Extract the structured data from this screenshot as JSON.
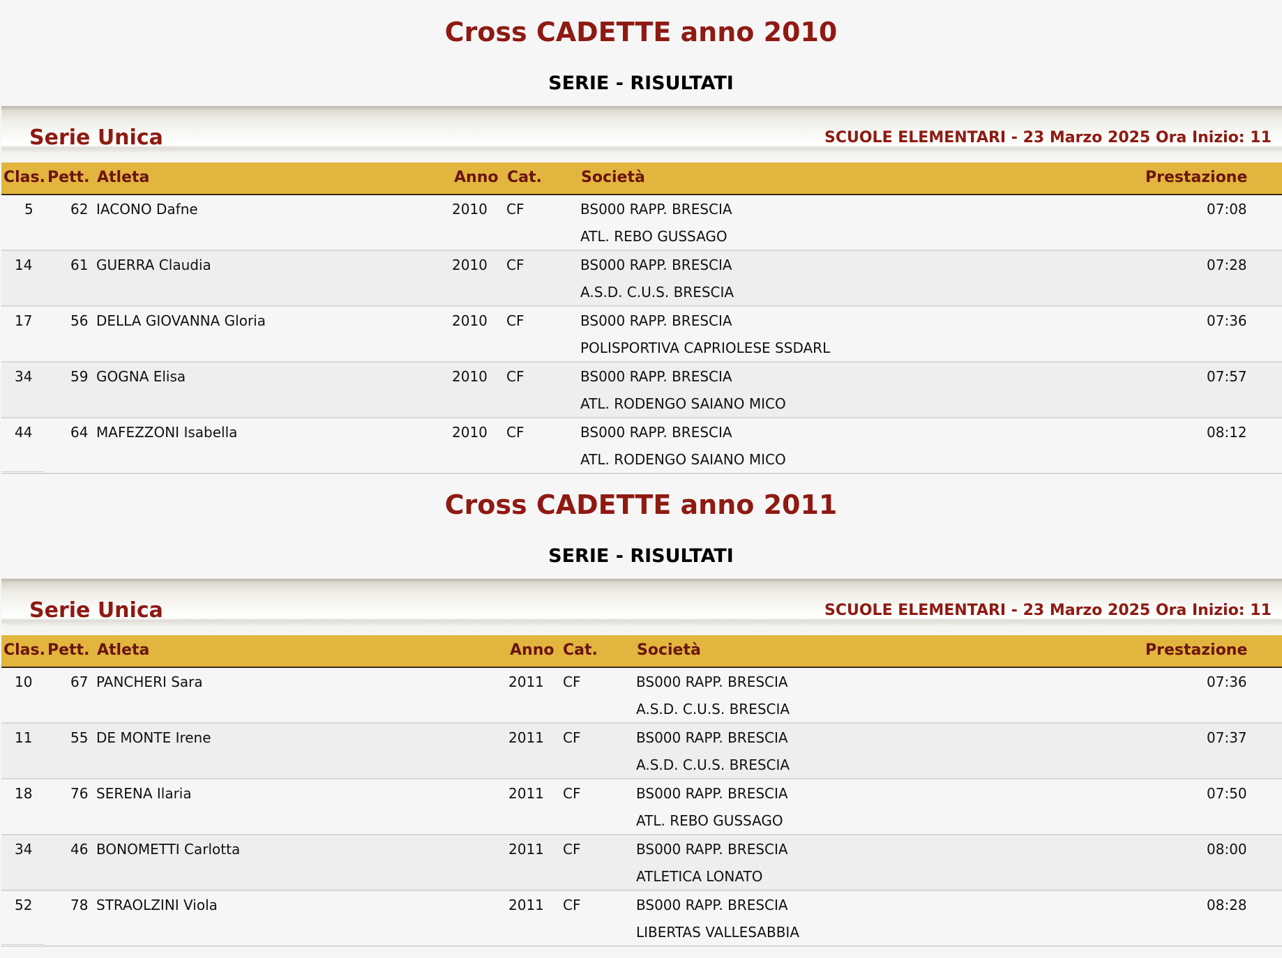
{
  "columns": {
    "clas": "Clas.",
    "pett": "Pett.",
    "atleta": "Atleta",
    "anno": "Anno",
    "cat": "Cat.",
    "societa": "Società",
    "prestazione": "Prestazione"
  },
  "sections": [
    {
      "title": "Cross CADETTE anno 2010",
      "subtitle": "SERIE - RISULTATI",
      "heat_name": "Serie Unica",
      "heat_info": "SCUOLE ELEMENTARI - 23 Marzo 2025 Ora Inizio: 11",
      "rows": [
        {
          "clas": "5",
          "pett": "62",
          "atleta": "IACONO Dafne",
          "anno": "2010",
          "cat": "CF",
          "societa": "BS000 RAPP. BRESCIA",
          "club": "ATL. REBO GUSSAGO",
          "prestazione": "07:08"
        },
        {
          "clas": "14",
          "pett": "61",
          "atleta": "GUERRA Claudia",
          "anno": "2010",
          "cat": "CF",
          "societa": "BS000 RAPP. BRESCIA",
          "club": "A.S.D. C.U.S. BRESCIA",
          "prestazione": "07:28"
        },
        {
          "clas": "17",
          "pett": "56",
          "atleta": "DELLA GIOVANNA Gloria",
          "anno": "2010",
          "cat": "CF",
          "societa": "BS000 RAPP. BRESCIA",
          "club": "POLISPORTIVA CAPRIOLESE SSDARL",
          "prestazione": "07:36"
        },
        {
          "clas": "34",
          "pett": "59",
          "atleta": "GOGNA Elisa",
          "anno": "2010",
          "cat": "CF",
          "societa": "BS000 RAPP. BRESCIA",
          "club": "ATL. RODENGO SAIANO MICO",
          "prestazione": "07:57"
        },
        {
          "clas": "44",
          "pett": "64",
          "atleta": "MAFEZZONI Isabella",
          "anno": "2010",
          "cat": "CF",
          "societa": "BS000 RAPP. BRESCIA",
          "club": "ATL. RODENGO SAIANO MICO",
          "prestazione": "08:12"
        }
      ]
    },
    {
      "title": "Cross CADETTE anno 2011",
      "subtitle": "SERIE - RISULTATI",
      "heat_name": "Serie Unica",
      "heat_info": "SCUOLE ELEMENTARI - 23 Marzo 2025 Ora Inizio: 11",
      "rows": [
        {
          "clas": "10",
          "pett": "67",
          "atleta": "PANCHERI Sara",
          "anno": "2011",
          "cat": "CF",
          "societa": "BS000 RAPP. BRESCIA",
          "club": "A.S.D. C.U.S. BRESCIA",
          "prestazione": "07:36"
        },
        {
          "clas": "11",
          "pett": "55",
          "atleta": "DE MONTE Irene",
          "anno": "2011",
          "cat": "CF",
          "societa": "BS000 RAPP. BRESCIA",
          "club": "A.S.D. C.U.S. BRESCIA",
          "prestazione": "07:37"
        },
        {
          "clas": "18",
          "pett": "76",
          "atleta": "SERENA Ilaria",
          "anno": "2011",
          "cat": "CF",
          "societa": "BS000 RAPP. BRESCIA",
          "club": "ATL. REBO GUSSAGO",
          "prestazione": "07:50"
        },
        {
          "clas": "34",
          "pett": "46",
          "atleta": "BONOMETTI Carlotta",
          "anno": "2011",
          "cat": "CF",
          "societa": "BS000 RAPP. BRESCIA",
          "club": "ATLETICA LONATO",
          "prestazione": "08:00"
        },
        {
          "clas": "52",
          "pett": "78",
          "atleta": "STRAOLZINI Viola",
          "anno": "2011",
          "cat": "CF",
          "societa": "BS000 RAPP. BRESCIA",
          "club": "LIBERTAS VALLESABBIA",
          "prestazione": "08:28"
        }
      ]
    }
  ]
}
